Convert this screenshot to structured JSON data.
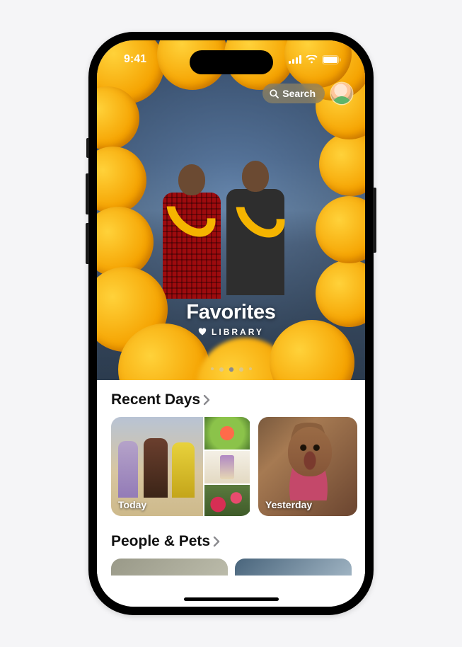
{
  "status": {
    "time": "9:41"
  },
  "topbar": {
    "search_label": "Search"
  },
  "hero": {
    "title": "Favorites",
    "subtitle": "LIBRARY"
  },
  "pager": {
    "count": 5,
    "active_index": 2
  },
  "sections": {
    "recent_days": {
      "header": "Recent Days",
      "cards": [
        {
          "label": "Today"
        },
        {
          "label": "Yesterday"
        }
      ]
    },
    "people_pets": {
      "header": "People & Pets"
    }
  }
}
